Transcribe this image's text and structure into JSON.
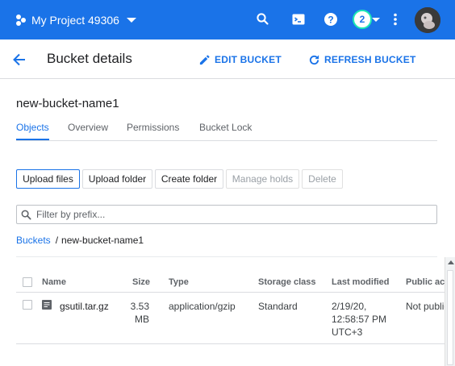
{
  "appbar": {
    "project_name": "My Project 49306",
    "notification_count": "2",
    "icons": [
      "project-icon",
      "search-icon",
      "cloud-shell-icon",
      "help-icon",
      "more-vert-icon",
      "avatar"
    ],
    "color": "#1a73e8"
  },
  "header": {
    "title": "Bucket details",
    "edit_label": "EDIT BUCKET",
    "refresh_label": "REFRESH BUCKET"
  },
  "bucket": {
    "name": "new-bucket-name1"
  },
  "tabs": [
    {
      "label": "Objects",
      "active": true
    },
    {
      "label": "Overview",
      "active": false
    },
    {
      "label": "Permissions",
      "active": false
    },
    {
      "label": "Bucket Lock",
      "active": false
    }
  ],
  "actions": {
    "upload_files": "Upload files",
    "upload_folder": "Upload folder",
    "create_folder": "Create folder",
    "manage_holds": "Manage holds",
    "delete": "Delete"
  },
  "filter": {
    "placeholder": "Filter by prefix..."
  },
  "breadcrumb": {
    "root": "Buckets",
    "separator": "/",
    "current": "new-bucket-name1"
  },
  "table": {
    "columns": [
      "Name",
      "Size",
      "Type",
      "Storage class",
      "Last modified",
      "Public access"
    ],
    "rows": [
      {
        "name": "gsutil.tar.gz",
        "size_value": "3.53",
        "size_unit": "MB",
        "type": "application/gzip",
        "storage_class": "Standard",
        "modified_date": "2/19/20,",
        "modified_time": "12:58:57 PM",
        "modified_tz": "UTC+3",
        "public_access": "Not public"
      }
    ]
  },
  "colors": {
    "accent": "#1a73e8",
    "text": "#202124",
    "muted": "#5f6368",
    "border": "#dadce0"
  }
}
